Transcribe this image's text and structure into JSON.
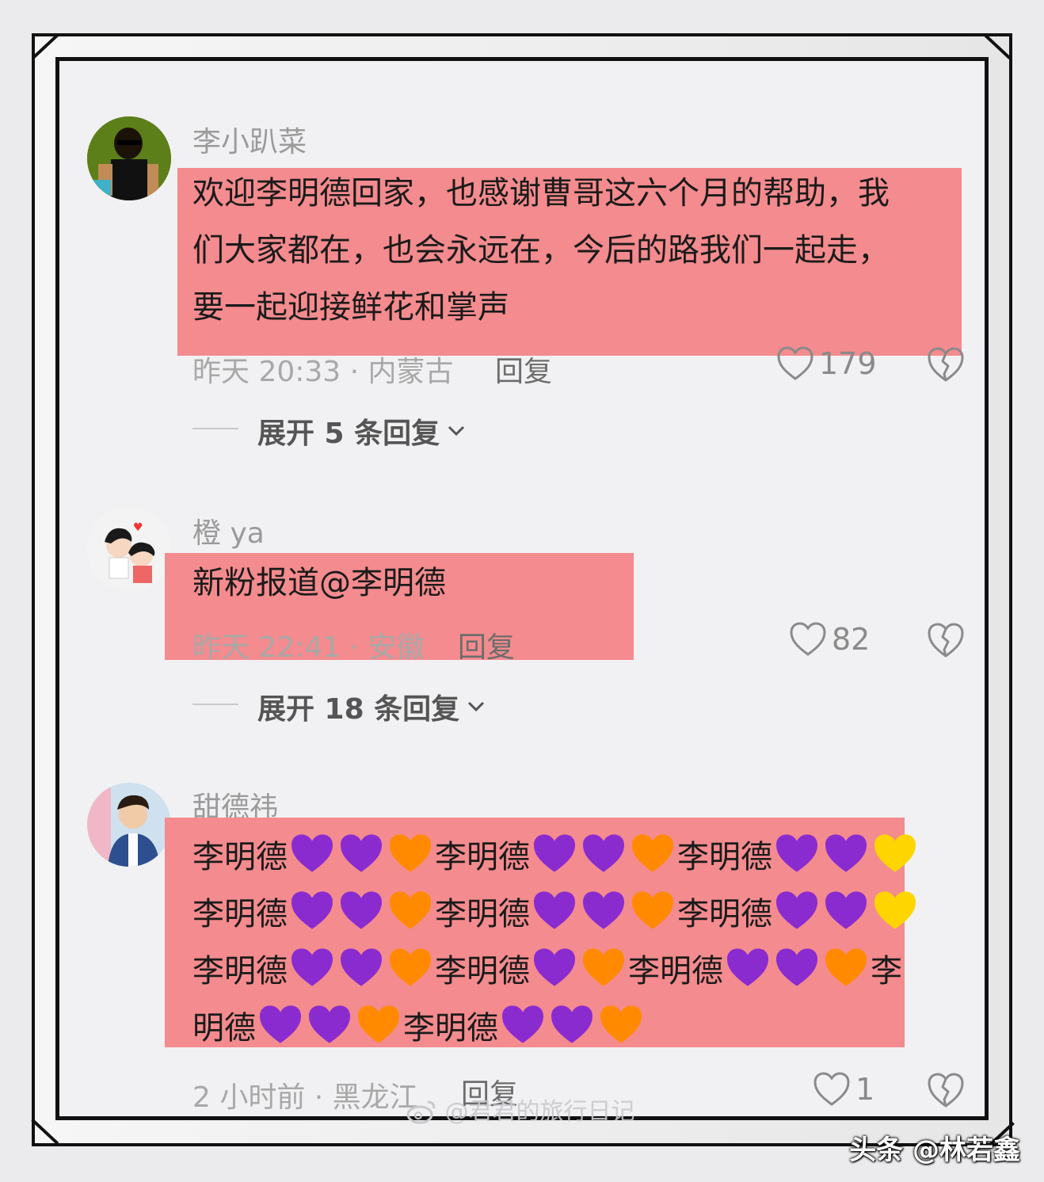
{
  "comments": [
    {
      "username": "李小趴菜",
      "text": "欢迎李明德回家，也感谢曹哥这六个月的帮助，我们大家都在，也会永远在，今后的路我们一起走，要一起迎接鲜花和掌声",
      "lines": [
        "欢迎李明德回家，也感谢曹哥这六个月的帮助，我",
        "们大家都在，也会永远在，今后的路我们一起走，",
        "要一起迎接鲜花和掌声"
      ],
      "time_location": "昨天 20:33 · 内蒙古",
      "reply_label": "回复",
      "likes": "179",
      "expand_label": "展开 5 条回复"
    },
    {
      "username": "橙 ya",
      "text": "新粉报道@李明德",
      "time_location": "昨天 22:41 · 安徽",
      "reply_label": "回复",
      "likes": "82",
      "expand_label": "展开 18 条回复"
    },
    {
      "username": "甜德祎",
      "name_token": "李明德",
      "line4_prefix": "明德",
      "line3_suffix": "李",
      "time_location": "2 小时前 · 黑龙江",
      "reply_label": "回复",
      "likes": "1"
    }
  ],
  "watermark": "@君君的旅行日记",
  "brand": "头条 @林若鑫",
  "colors": {
    "highlight": "#f48b8e",
    "purple_heart": "#8a2bd0",
    "orange_heart": "#ff8a00",
    "yellow_heart": "#ffd500"
  },
  "icons": [
    "heart-outline-icon",
    "broken-heart-icon",
    "chevron-down-icon",
    "purple-heart-emoji",
    "orange-heart-emoji",
    "yellow-heart-emoji",
    "weibo-logo-icon"
  ]
}
